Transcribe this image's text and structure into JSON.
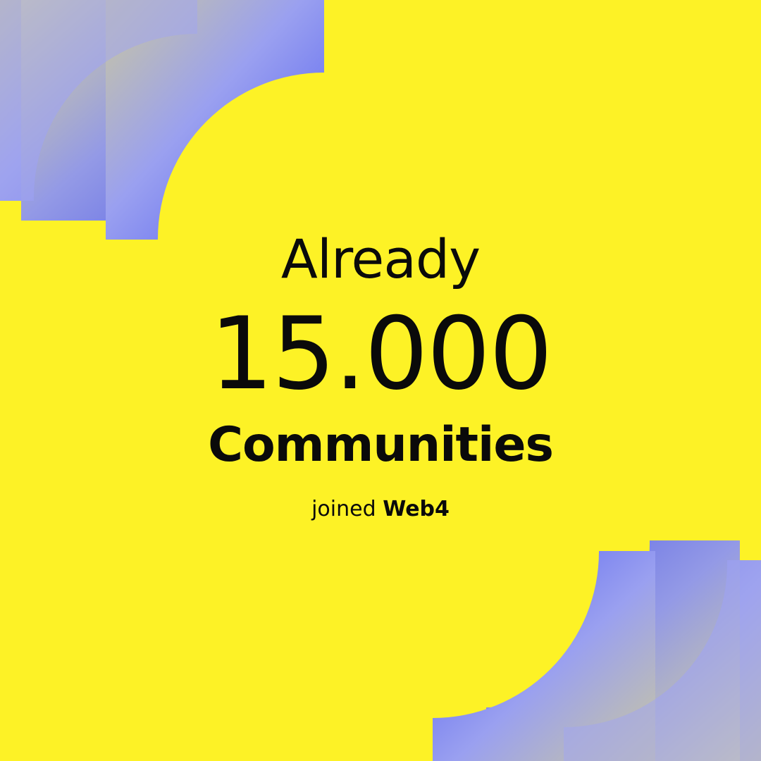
{
  "headline": {
    "kicker": "Already",
    "count": "15.000",
    "label": "Communities"
  },
  "footer": {
    "prefix": "joined",
    "brand": "Web4"
  },
  "colors": {
    "background": "#FDF226",
    "text": "#0A0A0A",
    "accent_blue": "#4A56F2",
    "accent_lavender": "#9AA0F0"
  },
  "decor": {
    "top_left": "quarter-arc-stack-shape",
    "bottom_right": "quarter-arc-stack-shape"
  }
}
